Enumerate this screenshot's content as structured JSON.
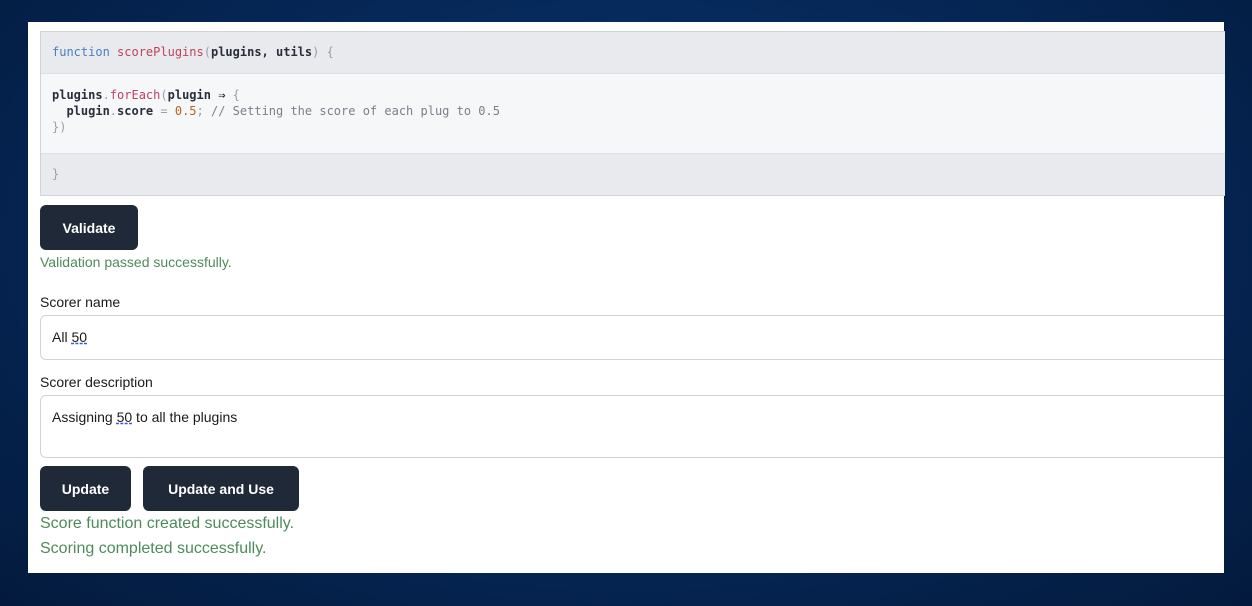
{
  "code": {
    "header": {
      "keyword": "function",
      "name": "scorePlugins",
      "open_paren": "(",
      "args": "plugins, utils",
      "close": ") {"
    },
    "body_lines": [
      {
        "a": "plugins",
        "b": ".",
        "c": "forEach",
        "d": "(",
        "e": "plugin ⇒ ",
        "f": "{"
      },
      {
        "a": "  plugin",
        "b": ".",
        "c": "score",
        "d": " = ",
        "e": "0.5",
        "f": ";",
        "g": " // Setting the score of each plug to 0.5"
      },
      {
        "a": "})"
      }
    ],
    "footer": "}"
  },
  "validate_button": "Validate",
  "validation_message": "Validation passed successfully.",
  "scorer_name": {
    "label": "Scorer name",
    "value_prefix": "All ",
    "value_highlight": "50"
  },
  "scorer_description": {
    "label": "Scorer description",
    "value_prefix": "Assigning ",
    "value_highlight": "50",
    "value_suffix": " to all the plugins"
  },
  "update_button": "Update",
  "update_and_use_button": "Update and Use",
  "messages": [
    "Score function created successfully.",
    "Scoring completed successfully."
  ],
  "colors": {
    "success": "#4e8a5a",
    "button_bg": "#1f2937",
    "background": "#062a5c"
  }
}
